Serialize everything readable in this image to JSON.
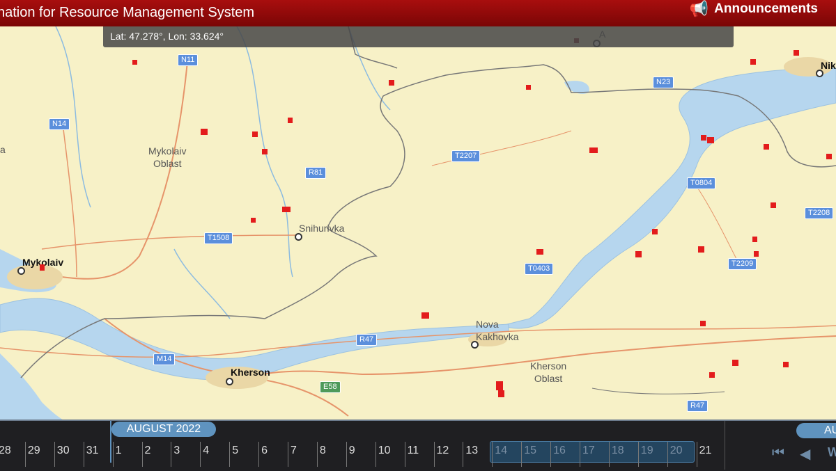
{
  "header": {
    "title": "nation for Resource Management System",
    "announcements_label": "Announcements"
  },
  "coords_readout": "Lat: 47.278°, Lon: 33.624°",
  "map": {
    "places": {
      "mykolaiv_oblast_line1": "Mykolaiv",
      "mykolaiv_oblast_line2": "Oblast",
      "snihurivka": "Snihurivka",
      "mykolaiv": "Mykolaiv",
      "kherson": "Kherson",
      "nova_kakhovka_line1": "Nova",
      "nova_kakhovka_line2": "Kakhovka",
      "kherson_oblast_line1": "Kherson",
      "kherson_oblast_line2": "Oblast",
      "niko": "Nik",
      "a_top": "A",
      "left_a": "a"
    },
    "roads": {
      "n11": "N11",
      "n14": "N14",
      "r81": "R81",
      "t2207": "T2207",
      "n23": "N23",
      "t0804": "T0804",
      "t2208": "T2208",
      "t1508": "T1508",
      "t0403": "T0403",
      "t2209": "T2209",
      "r47_west": "R47",
      "m14": "M14",
      "e58": "E58",
      "r47_east": "R47"
    },
    "colors": {
      "land": "#f7f1c7",
      "water": "#b6d6ee",
      "fire": "#e31c1c",
      "road": "#e6946a",
      "border": "#777777"
    }
  },
  "timeline": {
    "month_label": "AUGUST 2022",
    "next_month_label": "AU",
    "days_prev": [
      "28",
      "29",
      "30",
      "31"
    ],
    "days": [
      "1",
      "2",
      "3",
      "4",
      "5",
      "6",
      "7",
      "8",
      "9",
      "10",
      "11",
      "12",
      "13",
      "14",
      "15",
      "16",
      "17",
      "18",
      "19",
      "20",
      "21"
    ],
    "selected_range": [
      "14",
      "20"
    ],
    "controls": {
      "first_icon": "skip-to-start-icon",
      "prev_icon": "step-back-icon",
      "partial_label": "W"
    }
  }
}
